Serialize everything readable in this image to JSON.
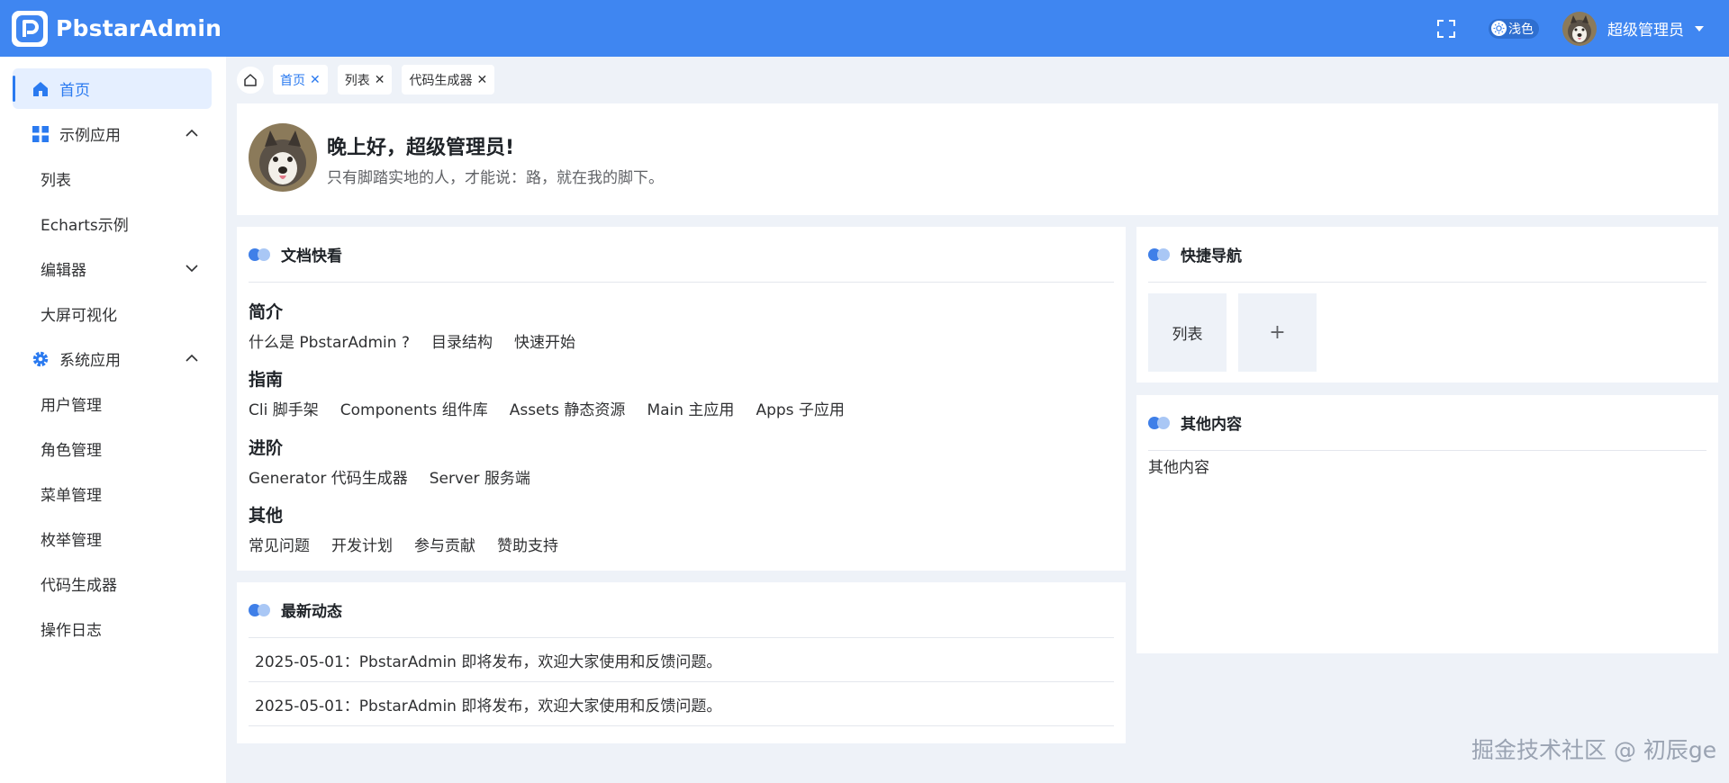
{
  "app": {
    "title": "PbstarAdmin"
  },
  "header": {
    "theme_label": "浅色",
    "user_name": "超级管理员",
    "icons": [
      "fullscreen-icon",
      "sun-icon",
      "chevron-down-icon"
    ]
  },
  "sidebar": {
    "items": [
      {
        "label": "首页",
        "icon": "home-icon",
        "active": true
      },
      {
        "label": "示例应用",
        "icon": "grid-icon",
        "expanded": true
      },
      {
        "label": "列表"
      },
      {
        "label": "Echarts示例"
      },
      {
        "label": "编辑器",
        "expanded": false
      },
      {
        "label": "大屏可视化"
      },
      {
        "label": "系统应用",
        "icon": "gear-icon",
        "expanded": true
      },
      {
        "label": "用户管理"
      },
      {
        "label": "角色管理"
      },
      {
        "label": "菜单管理"
      },
      {
        "label": "枚举管理"
      },
      {
        "label": "代码生成器"
      },
      {
        "label": "操作日志"
      }
    ]
  },
  "tabs": [
    {
      "label": "首页",
      "active": true
    },
    {
      "label": "列表"
    },
    {
      "label": "代码生成器"
    }
  ],
  "welcome": {
    "greeting": "晚上好，超级管理员!",
    "motto": "只有脚踏实地的人，才能说：路，就在我的脚下。"
  },
  "docs": {
    "title": "文档快看",
    "sections": [
      {
        "title": "简介",
        "links": [
          "什么是 PbstarAdmin ?",
          "目录结构",
          "快速开始"
        ]
      },
      {
        "title": "指南",
        "links": [
          "Cli 脚手架",
          "Components 组件库",
          "Assets 静态资源",
          "Main 主应用",
          "Apps 子应用"
        ]
      },
      {
        "title": "进阶",
        "links": [
          "Generator 代码生成器",
          "Server 服务端"
        ]
      },
      {
        "title": "其他",
        "links": [
          "常见问题",
          "开发计划",
          "参与贡献",
          "赞助支持"
        ]
      }
    ]
  },
  "news": {
    "title": "最新动态",
    "items": [
      "2025-05-01：PbstarAdmin 即将发布，欢迎大家使用和反馈问题。",
      "2025-05-01：PbstarAdmin 即将发布，欢迎大家使用和反馈问题。"
    ]
  },
  "quick_nav": {
    "title": "快捷导航",
    "items": [
      "列表",
      "+"
    ]
  },
  "other": {
    "title": "其他内容",
    "body": "其他内容"
  },
  "watermark": "掘金技术社区 @ 初辰ge",
  "colors": {
    "primary": "#3f86f1",
    "accent": "#2a7af0",
    "page_bg": "#eef2f8"
  }
}
